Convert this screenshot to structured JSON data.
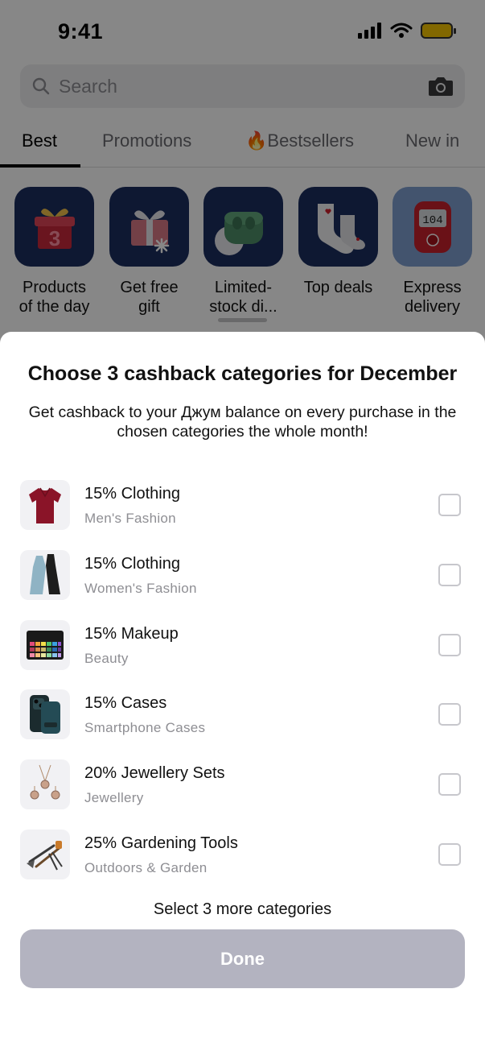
{
  "status_bar": {
    "time": "9:41"
  },
  "search": {
    "placeholder": "Search"
  },
  "tabs": [
    {
      "label": "Best",
      "active": true
    },
    {
      "label": "Promotions"
    },
    {
      "label": "🔥Bestsellers"
    },
    {
      "label": "New in"
    }
  ],
  "quick_categories": [
    {
      "line1": "Products",
      "line2": "of the day",
      "icon": "gift-box-3-icon"
    },
    {
      "line1": "Get free",
      "line2": "gift",
      "icon": "gift-icon"
    },
    {
      "line1": "Limited-",
      "line2": "stock di...",
      "icon": "earbuds-icon"
    },
    {
      "line1": "Top deals",
      "line2": "",
      "icon": "socks-icon"
    },
    {
      "line1": "Express",
      "line2": "delivery",
      "icon": "glucometer-icon"
    }
  ],
  "sheet": {
    "title": "Choose 3 cashback categories for December",
    "subtitle": "Get cashback to your Джум balance on every purchase in the chosen categories the whole month!",
    "items": [
      {
        "title": "15% Clothing",
        "subtitle": "Men's Fashion",
        "icon": "polo-shirt-icon",
        "checked": false
      },
      {
        "title": "15% Clothing",
        "subtitle": "Women's Fashion",
        "icon": "dresses-icon",
        "checked": false
      },
      {
        "title": "15% Makeup",
        "subtitle": "Beauty",
        "icon": "eyeshadow-palette-icon",
        "checked": false
      },
      {
        "title": "15% Cases",
        "subtitle": "Smartphone Cases",
        "icon": "phone-case-icon",
        "checked": false
      },
      {
        "title": "20% Jewellery Sets",
        "subtitle": "Jewellery",
        "icon": "jewellery-set-icon",
        "checked": false
      },
      {
        "title": "25% Gardening Tools",
        "subtitle": "Outdoors & Garden",
        "icon": "garden-tools-icon",
        "checked": false
      }
    ],
    "hint": "Select 3 more categories",
    "done_label": "Done"
  },
  "colors": {
    "tile_navy": "#1c2e5f",
    "done_disabled": "#b3b3c0",
    "checkbox_border": "#c7c7cc",
    "subtitle_gray": "#8e8e93"
  }
}
